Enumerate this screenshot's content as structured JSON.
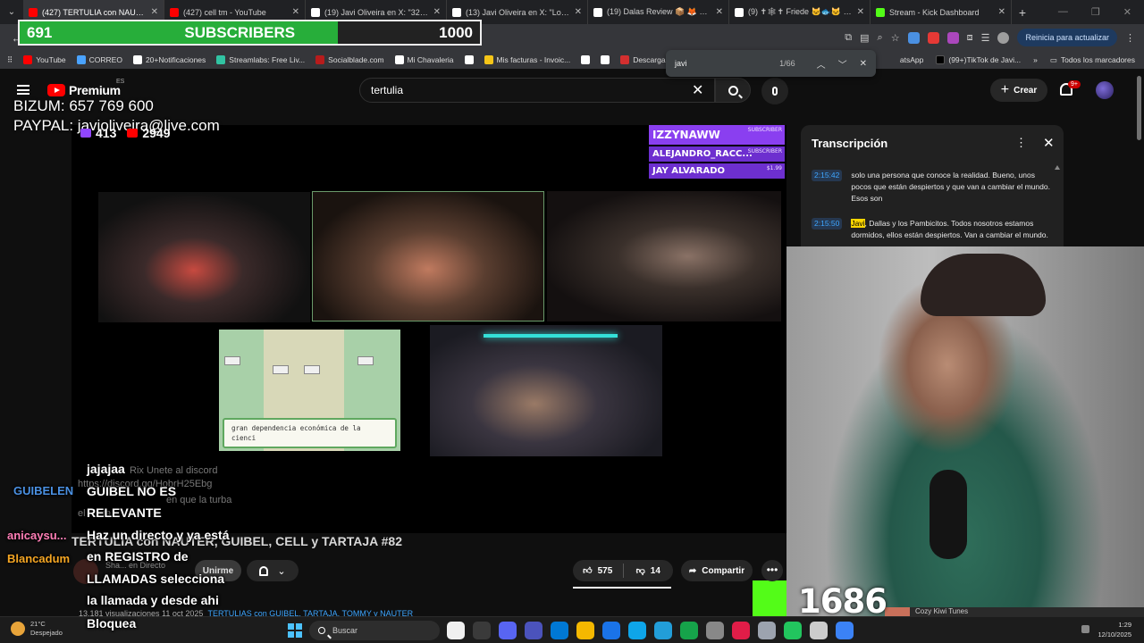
{
  "browser": {
    "tabs": [
      {
        "title": "(427) TERTULIA con NAUTER",
        "active": true,
        "favicon_color": "#ff0000"
      },
      {
        "title": "(427) cell tm - YouTube",
        "active": false,
        "favicon_color": "#ff0000"
      },
      {
        "title": "(19) Javi Oliveira en X: \"32.000",
        "active": false,
        "favicon_color": "#ffffff"
      },
      {
        "title": "(13) Javi Oliveira en X: \"Los enf",
        "active": false,
        "favicon_color": "#ffffff"
      },
      {
        "title": "(19) Dalas Review 📦 🦊 🌍 en",
        "active": false,
        "favicon_color": "#ffffff"
      },
      {
        "title": "(9) ✝🕸✝ Friede 🐱🐟🐱 en X: \"V",
        "active": false,
        "favicon_color": "#ffffff"
      },
      {
        "title": "Stream - Kick Dashboard",
        "active": false,
        "favicon_color": "#53fc18"
      }
    ],
    "close_glyph": "✕",
    "new_tab": "+",
    "update_button": "Reinicia para actualizar",
    "bookmarks": [
      {
        "label": "YouTube",
        "color": "#ff0000"
      },
      {
        "label": "CORREO",
        "color": "#4aa3ff"
      },
      {
        "label": "20+Notificaciones",
        "color": "#ffffff"
      },
      {
        "label": "Streamlabs: Free Liv...",
        "color": "#31c3a2"
      },
      {
        "label": "Socialblade.com",
        "color": "#b71c1c"
      },
      {
        "label": "Mi Chavaleria",
        "color": "#ffffff"
      },
      {
        "label": "",
        "color": "#ffffff"
      },
      {
        "label": "Mis facturas - Invoic...",
        "color": "#f5c518"
      },
      {
        "label": "",
        "color": "#ffffff"
      },
      {
        "label": "",
        "color": "#ffffff"
      },
      {
        "label": "Descargado",
        "color": "#d32f2f"
      }
    ],
    "bookmark_extra": [
      "atsApp",
      "(99+)TikTok de Javi..."
    ],
    "all_bookmarks": "Todos los marcadores",
    "find": {
      "query": "javi",
      "count": "1/66"
    }
  },
  "youtube": {
    "logo": "Premium",
    "country": "ES",
    "search_value": "tertulia",
    "create_label": "Crear",
    "notifications": "9+",
    "video_title": "TERTULIA con NAUTER, GUIBEL, CELL y TARTAJA #82",
    "channel_line": "Sha... en Directo",
    "join_label": "Unirme",
    "likes": "575",
    "dislikes": "14",
    "share_label": "Compartir",
    "more": "•••",
    "description_stats": "13.181 visualizaciones  11 oct 2025",
    "description_tags": "TERTULIAS con GUIBEL, TARTAJA, TOMMY y NAUTER"
  },
  "stream": {
    "sub_goal": {
      "current": "691",
      "label": "SUBSCRIBERS",
      "target": "1000",
      "progress": 0.691,
      "fill_color": "#27ae3a"
    },
    "donation_lines": [
      "BIZUM: 657 769 600",
      "PAYPAL: javioliveira@live.com"
    ],
    "viewers": [
      {
        "value": "413",
        "color": "#9146ff"
      },
      {
        "value": "2949",
        "color": "#ff0000"
      }
    ],
    "sub_alerts": [
      {
        "name": "IZZYNAWW",
        "tag": "SUBSCRIBER"
      },
      {
        "name": "ALEJANDRO_RACC...",
        "tag": "SUBSCRIBER"
      },
      {
        "name": "JAY ALVARADO",
        "tag": "$1.99"
      }
    ],
    "game_text": "gran dependencia económica de la cienci",
    "kick_count": "1686",
    "kick_color": "#53fc18",
    "music": "Cozy Kiwi Tunes"
  },
  "transcript": {
    "title": "Transcripción",
    "segments": [
      {
        "time": "2:15:42",
        "text": "solo una persona que conoce la realidad. Bueno, unos pocos que están despiertos y que van a cambiar el mundo. Esos son"
      },
      {
        "time": "2:15:50",
        "highlight": "Javi",
        "text": ", Dallas y los Pambicitos. Todos nosotros estamos dormidos, ellos están despiertos. Van a cambiar el mundo."
      }
    ]
  },
  "chat": {
    "ghost": [
      {
        "text": "Rix  Unete al discord"
      },
      {
        "text": "https://discord.gg/HobrH25Ebg"
      },
      {
        "text": "en que la turba"
      },
      {
        "text": "el ... rra"
      }
    ],
    "users": [
      {
        "name": "GUIBELEN",
        "color": "#4a90e2"
      },
      {
        "name": "anicaysu...",
        "color": "#ff7eb6"
      },
      {
        "name": "Blancadum",
        "color": "#f5a623"
      }
    ],
    "messages": [
      "jajajaa",
      "GUIBEL NO ES",
      "RELEVANTE",
      "Haz un directo y ya está",
      "en REGISTRO de",
      "LLAMADAS selecciona",
      "la llamada y desde ahi",
      "Bloquea"
    ]
  },
  "taskbar": {
    "temperature": "21°C",
    "weather": "Despejado",
    "search": "Buscar",
    "time": "1:29",
    "date": "12/10/2025",
    "apps": [
      "#f0f0f0",
      "#3a3a3a",
      "#5865f2",
      "#4b53bc",
      "#0078d4",
      "#f5b800",
      "#1a73e8",
      "#0ea5e9",
      "#229ed9",
      "#16a34a",
      "#888888",
      "#e11d48",
      "#9ca3af",
      "#22c55e",
      "#cccccc",
      "#3b82f6"
    ]
  }
}
